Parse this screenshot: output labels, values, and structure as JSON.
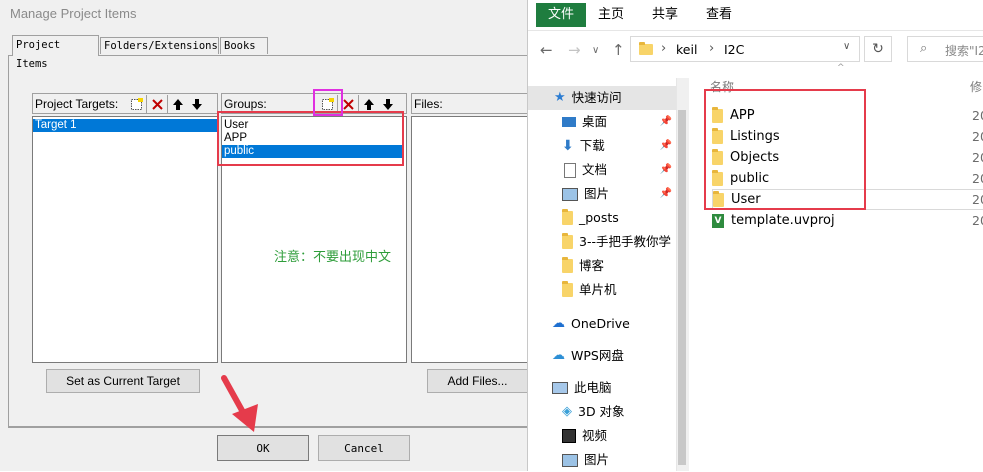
{
  "dialog": {
    "title": "Manage Project Items",
    "tabs": [
      "Project Items",
      "Folders/Extensions",
      "Books"
    ],
    "targets_label": "Project Targets:",
    "groups_label": "Groups:",
    "files_label": "Files:",
    "targets": [
      "Target 1"
    ],
    "groups": [
      "User",
      "APP",
      "public"
    ],
    "selected_group": "public",
    "note": "注意：不要出现中文",
    "set_current_label": "Set as Current Target",
    "add_files_label": "Add Files...",
    "ok_label": "OK",
    "cancel_label": "Cancel"
  },
  "explorer": {
    "ribbon_tabs": [
      "文件",
      "主页",
      "共享",
      "查看"
    ],
    "breadcrumb": [
      "keil",
      "I2C"
    ],
    "search_placeholder": "搜索\"I2",
    "column_name": "名称",
    "column_modified": "修",
    "nav_items": [
      {
        "label": "快速访问",
        "icon": "star-icon"
      },
      {
        "label": "桌面",
        "icon": "desktop-icon",
        "pinned": true
      },
      {
        "label": "下载",
        "icon": "download-icon",
        "pinned": true
      },
      {
        "label": "文档",
        "icon": "document-icon",
        "pinned": true
      },
      {
        "label": "图片",
        "icon": "picture-icon",
        "pinned": true
      },
      {
        "label": "_posts",
        "icon": "folder-icon"
      },
      {
        "label": "3--手把手教你学",
        "icon": "folder-icon"
      },
      {
        "label": "博客",
        "icon": "folder-icon"
      },
      {
        "label": "单片机",
        "icon": "folder-icon"
      },
      {
        "label": "OneDrive",
        "icon": "cloud-icon"
      },
      {
        "label": "WPS网盘",
        "icon": "cloud-icon"
      },
      {
        "label": "此电脑",
        "icon": "computer-icon"
      },
      {
        "label": "3D 对象",
        "icon": "cube-icon"
      },
      {
        "label": "视频",
        "icon": "video-icon"
      },
      {
        "label": "图片",
        "icon": "picture-icon"
      }
    ],
    "files": [
      {
        "name": "APP",
        "type": "folder",
        "modified": "20"
      },
      {
        "name": "Listings",
        "type": "folder",
        "modified": "20"
      },
      {
        "name": "Objects",
        "type": "folder",
        "modified": "20"
      },
      {
        "name": "public",
        "type": "folder",
        "modified": "20"
      },
      {
        "name": "User",
        "type": "folder",
        "modified": "20"
      },
      {
        "name": "template.uvproj",
        "type": "uvproj",
        "modified": "20"
      }
    ]
  },
  "colors": {
    "selection": "#0078d7",
    "annotation_red": "#e53b4b",
    "annotation_pink": "#e030e0",
    "note_green": "#2e9d3a",
    "ribbon_file": "#1f7d3f"
  }
}
